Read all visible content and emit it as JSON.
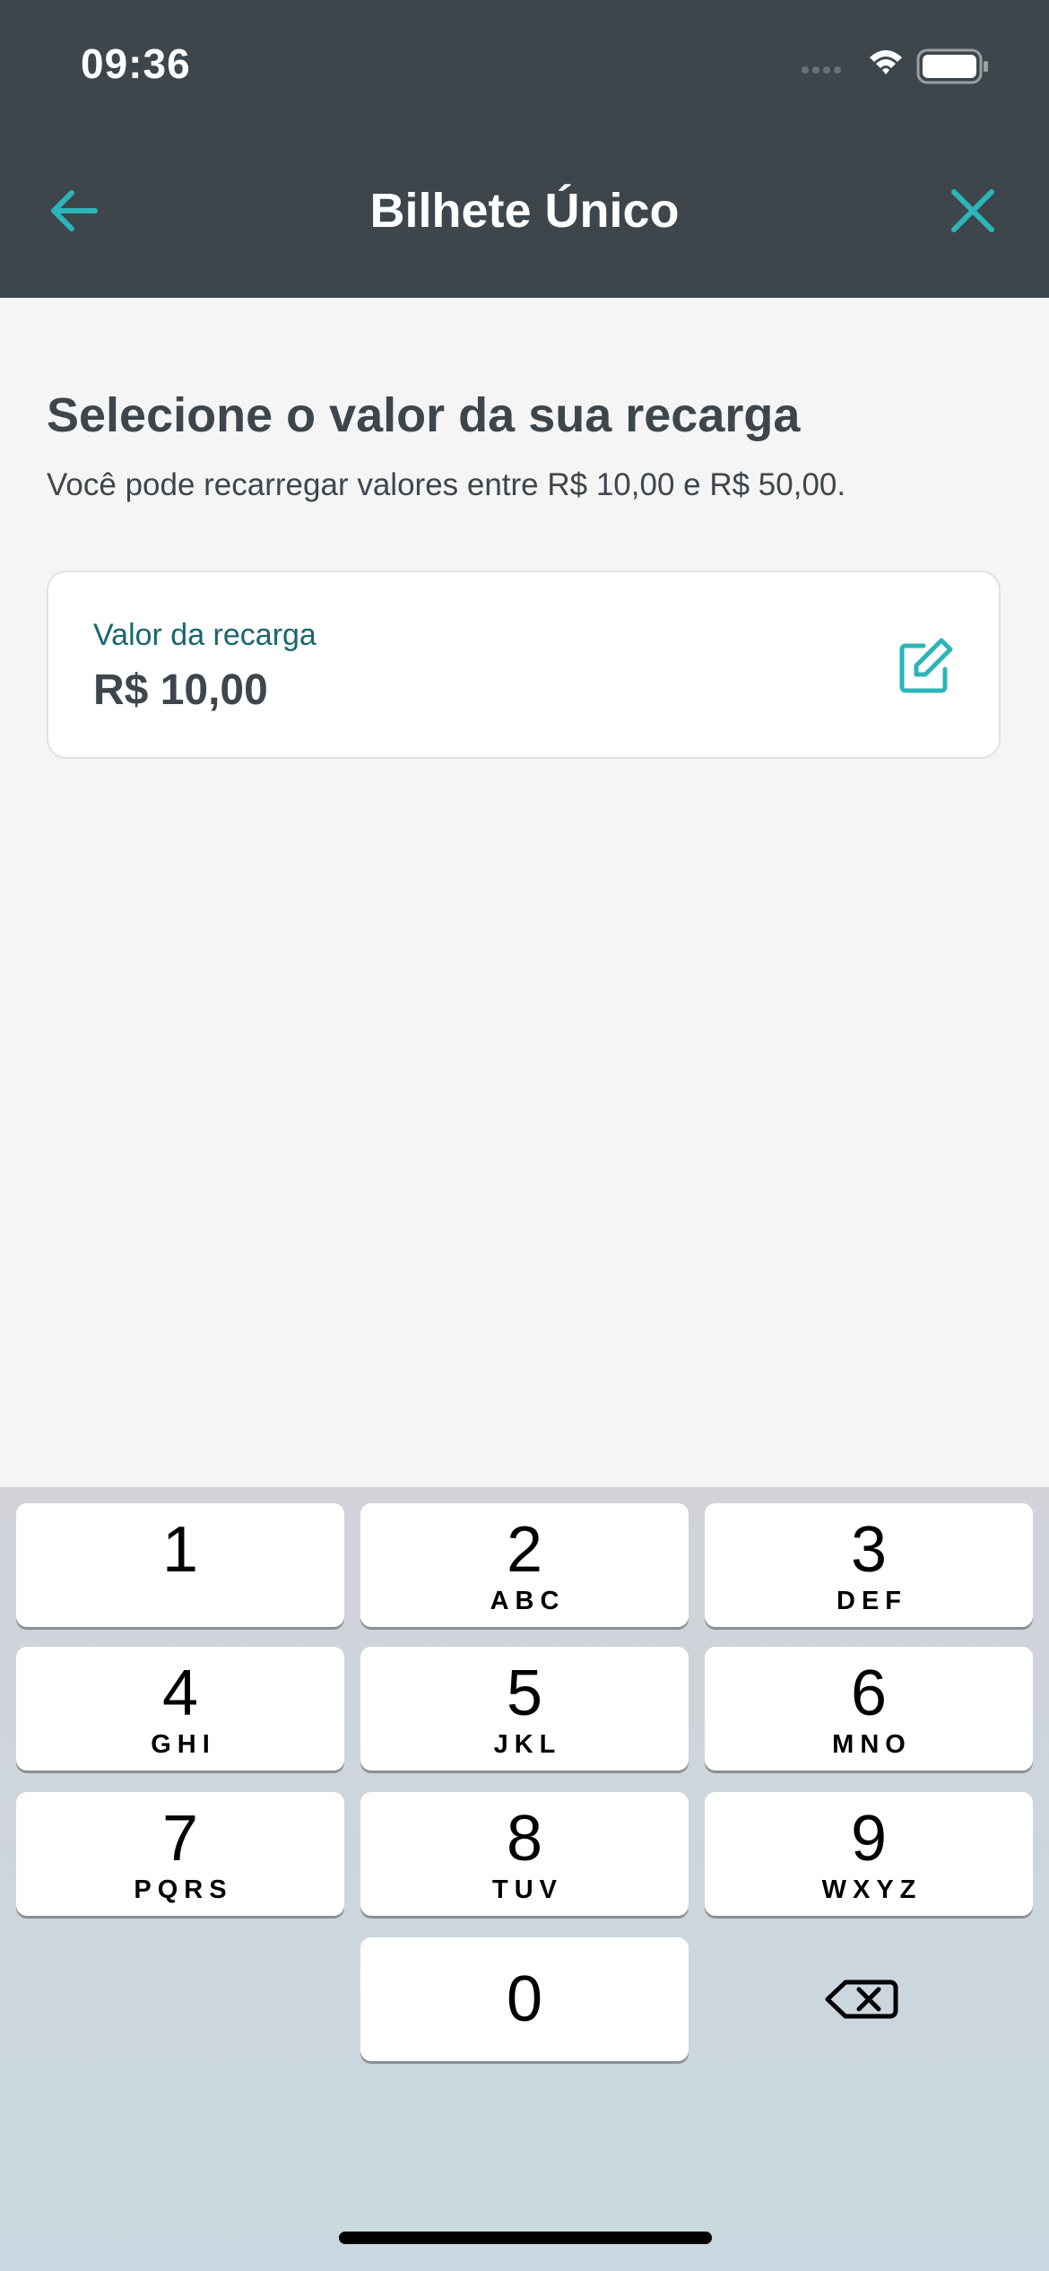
{
  "status_bar": {
    "time": "09:36",
    "icons": [
      "signal-icon",
      "wifi-icon",
      "battery-icon"
    ]
  },
  "nav": {
    "title": "Bilhete Único",
    "back_icon": "arrow-left-icon",
    "close_icon": "close-icon"
  },
  "main": {
    "headline": "Selecione o valor da sua recarga",
    "subtext": "Você pode recarregar valores entre R$ 10,00 e R$ 50,00."
  },
  "amount_card": {
    "label": "Valor da recarga",
    "value": "R$ 10,00",
    "edit_icon": "edit-icon"
  },
  "keypad": {
    "keys": [
      {
        "digit": "1",
        "letters": ""
      },
      {
        "digit": "2",
        "letters": "ABC"
      },
      {
        "digit": "3",
        "letters": "DEF"
      },
      {
        "digit": "4",
        "letters": "GHI"
      },
      {
        "digit": "5",
        "letters": "JKL"
      },
      {
        "digit": "6",
        "letters": "MNO"
      },
      {
        "digit": "7",
        "letters": "PQRS"
      },
      {
        "digit": "8",
        "letters": "TUV"
      },
      {
        "digit": "9",
        "letters": "WXYZ"
      },
      {
        "digit": "0",
        "letters": ""
      }
    ],
    "delete_icon": "backspace-icon"
  },
  "colors": {
    "header_bg": "#3e464c",
    "accent": "#2bb5b8",
    "text_dark": "#3e464c",
    "label_teal": "#17676e",
    "page_bg": "#f5f5f5"
  }
}
